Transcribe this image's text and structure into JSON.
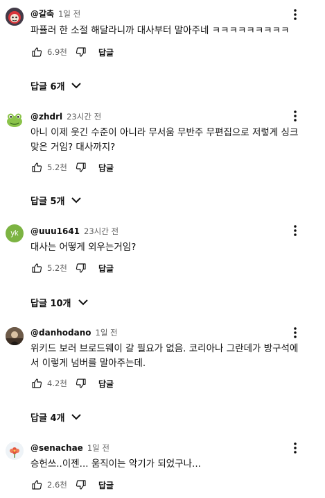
{
  "comments": [
    {
      "author": "@갈축",
      "time": "1일 전",
      "text": "파퓰러 한 소절 해달라니까 대사부터 말아주네 ㅋㅋㅋㅋㅋㅋㅋㅋㅋ",
      "likes": "6.9천",
      "reply_label": "답글",
      "replies_label": "답글 6개",
      "avatar_icon": "red-cartoon-avatar"
    },
    {
      "author": "@zhdrl",
      "time": "23시간 전",
      "text": "아니 이제 웃긴 수준이 아니라 무서움 무반주 무편집으로 저렇게 싱크\n맞은 거임? 대사까지?",
      "likes": "5.2천",
      "reply_label": "답글",
      "replies_label": "답글 5개",
      "avatar_icon": "green-frog-avatar"
    },
    {
      "author": "@uuu1641",
      "time": "23시간 전",
      "text": "대사는 어떻게 외우는거임?",
      "likes": "5.2천",
      "reply_label": "답글",
      "replies_label": "답글 10개",
      "avatar_icon": "letter-avatar",
      "avatar_letter": "yk"
    },
    {
      "author": "@danhodano",
      "time": "1일 전",
      "text": "위키드 보러 브로드웨이 갈 필요가 없음. 코리아나 그란데가 방구석에\n서 이렇게 넘버를 말아주는데.",
      "likes": "4.2천",
      "reply_label": "답글",
      "replies_label": "답글 4개",
      "avatar_icon": "photo-avatar"
    },
    {
      "author": "@senachae",
      "time": "1일 전",
      "text": "승헌쓰..이젠... 움직이는 악기가 되었구나...",
      "likes": "2.6천",
      "reply_label": "답글",
      "avatar_icon": "flower-avatar"
    }
  ],
  "colors": {
    "text": "#0f0f0f",
    "secondary": "#606060",
    "letter_avatar_bg": "#7cb342"
  }
}
